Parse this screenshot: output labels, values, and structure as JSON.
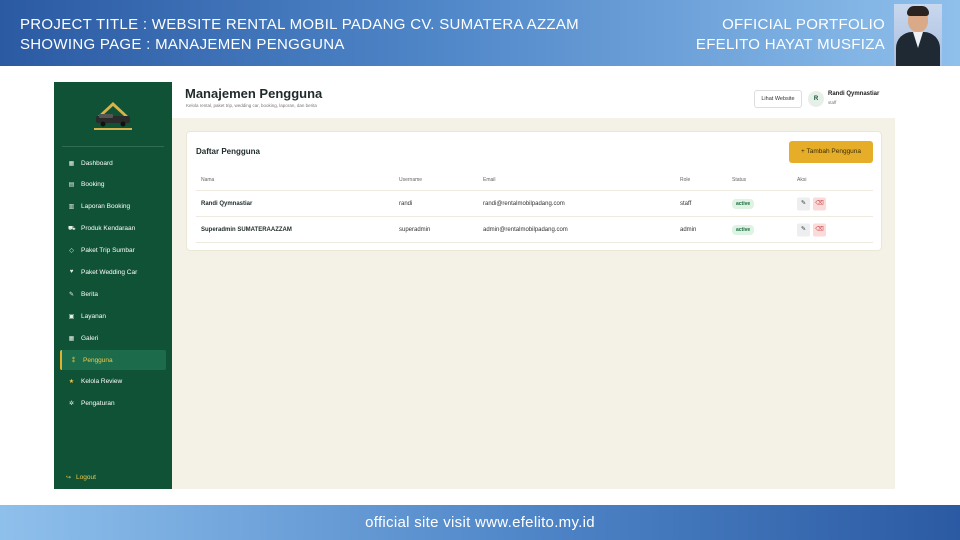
{
  "banner": {
    "project_title": "PROJECT TITLE : WEBSITE RENTAL MOBIL PADANG CV. SUMATERA AZZAM",
    "showing_page": "SHOWING PAGE : MANAJEMEN PENGGUNA",
    "official_portfolio": "OFFICIAL PORTFOLIO",
    "author": "EFELITO HAYAT MUSFIZA",
    "footer": "official site visit www.efelito.my.id"
  },
  "sidebar": {
    "items": [
      {
        "label": "Dashboard",
        "icon": "grid-icon",
        "glyph": "▦"
      },
      {
        "label": "Booking",
        "icon": "calendar-icon",
        "glyph": "▤"
      },
      {
        "label": "Laporan Booking",
        "icon": "report-icon",
        "glyph": "▥"
      },
      {
        "label": "Produk Kendaraan",
        "icon": "car-icon",
        "glyph": "⛟"
      },
      {
        "label": "Paket Trip Sumbar",
        "icon": "map-pin-icon",
        "glyph": "◇"
      },
      {
        "label": "Paket Wedding Car",
        "icon": "wedding-icon",
        "glyph": "♥"
      },
      {
        "label": "Berita",
        "icon": "news-icon",
        "glyph": "✎"
      },
      {
        "label": "Layanan",
        "icon": "service-icon",
        "glyph": "▣"
      },
      {
        "label": "Galeri",
        "icon": "gallery-icon",
        "glyph": "▦"
      },
      {
        "label": "Pengguna",
        "icon": "users-icon",
        "glyph": "⁑"
      },
      {
        "label": "Kelola Review",
        "icon": "star-icon",
        "glyph": "★"
      },
      {
        "label": "Pengaturan",
        "icon": "gear-icon",
        "glyph": "✲"
      }
    ],
    "active_index": 9,
    "logout_label": "Logout"
  },
  "header": {
    "title": "Manajemen Pengguna",
    "subtitle": "Kelola rental, paket trip, wedding car, booking, laporan, dan berita",
    "view_site_label": "Lihat Website",
    "avatar_initial": "R",
    "user_name": "Randi Qymnastiar",
    "user_role": "staff"
  },
  "users_card": {
    "title": "Daftar Pengguna",
    "add_button_label": "+ Tambah Pengguna",
    "columns": [
      "Nama",
      "Username",
      "Email",
      "Role",
      "Status",
      "Aksi"
    ],
    "rows": [
      {
        "name": "Randi Qymnastiar",
        "username": "randi",
        "email": "randi@rentalmobilpadang.com",
        "role": "staff",
        "status": "active"
      },
      {
        "name": "Superadmin SUMATERAAZZAM",
        "username": "superadmin",
        "email": "admin@rentalmobilpadang.com",
        "role": "admin",
        "status": "active"
      }
    ]
  },
  "colors": {
    "sidebar_bg": "#0f5236",
    "accent": "#e6ae28",
    "status_active": "#1a6b3d",
    "delete": "#c53a3a"
  }
}
